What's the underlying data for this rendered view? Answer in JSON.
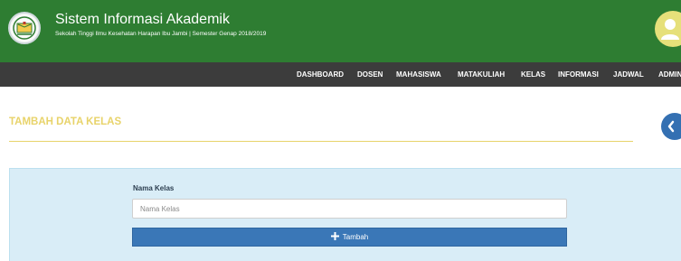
{
  "header": {
    "title": "Sistem Informasi Akademik",
    "subtitle": "Sekolah Tinggi Ilmu Kesehatan Harapan Ibu Jambi | Semester Genap 2018/2019"
  },
  "nav": {
    "items": [
      {
        "label": "DASHBOARD"
      },
      {
        "label": "DOSEN"
      },
      {
        "label": "MAHASISWA"
      },
      {
        "label": "MATAKULIAH"
      },
      {
        "label": "KELAS"
      },
      {
        "label": "INFORMASI"
      },
      {
        "label": "JADWAL"
      },
      {
        "label": "ADMIN"
      }
    ]
  },
  "page": {
    "title": "TAMBAH DATA KELAS"
  },
  "form": {
    "label": "Nama Kelas",
    "input_value": "",
    "input_placeholder": "Nama Kelas",
    "submit_label": "Tambah",
    "submit_icon": "plus-icon"
  },
  "colors": {
    "header_bg": "#2e7d32",
    "navbar_bg": "#3c3c3c",
    "accent_yellow": "#e8d36a",
    "panel_bg": "#d9edf7",
    "primary_button": "#3a77b7"
  }
}
